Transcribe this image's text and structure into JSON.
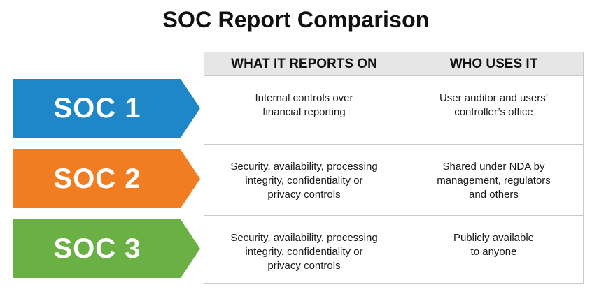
{
  "title": "SOC Report Comparison",
  "headers": {
    "reports_on": "WHAT IT REPORTS ON",
    "who_uses": "WHO USES IT"
  },
  "rows": [
    {
      "label": "SOC 1",
      "color": "#1f86c8",
      "reports_on": "Internal controls over\nfinancial reporting",
      "who_uses": "User auditor and users’\ncontroller’s office"
    },
    {
      "label": "SOC 2",
      "color": "#f07d22",
      "reports_on": "Security, availability, processing\nintegrity, confidentiality or\nprivacy controls",
      "who_uses": "Shared under NDA  by\nmanagement, regulators\nand others"
    },
    {
      "label": "SOC 3",
      "color": "#6ab045",
      "reports_on": "Security, availability, processing\nintegrity, confidentiality or\nprivacy controls",
      "who_uses": "Publicly available\nto anyone"
    }
  ]
}
